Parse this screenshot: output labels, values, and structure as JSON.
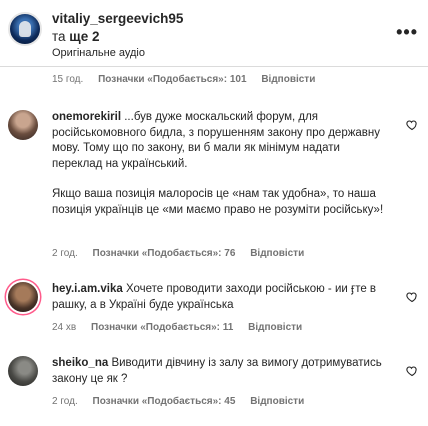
{
  "header": {
    "username": "vitaliy_sergeevich95",
    "subtitle_prefix": "та ",
    "subtitle_bold": "ще 2",
    "audio": "Оригінальне аудіо"
  },
  "top_meta": {
    "time": "15 год.",
    "likes": "Позначки «Подобається»: 101",
    "reply": "Відповісти"
  },
  "comments": [
    {
      "username": "onemorekiril",
      "text1": "...був дуже москальский форум, для російськомовного бидла, з порушенням закону про державну мову. Тому що по закону, ви б мали як мінімум надати переклад на український.",
      "text2": "Якщо ваша позиція малоросів це «нам так удобна», то наша позиція українців це «ми маємо право не розуміти російську»!",
      "time": "2 год.",
      "likes": "Позначки «Подобається»: 76",
      "reply": "Відповісти"
    },
    {
      "username": "hey.i.am.vika",
      "text1": "Хочете проводити заходи російською - ии   ӻте в рашку, а в Україні буде українська",
      "time": "24 хв",
      "likes": "Позначки «Подобається»: 11",
      "reply": "Відповісти"
    },
    {
      "username": "sheiko_na",
      "text1": "Виводити дівчину із залу за вимогу дотримуватись закону це як ?",
      "time": "2 год.",
      "likes": "Позначки «Подобається»: 45",
      "reply": "Відповісти"
    }
  ],
  "icons": {
    "more": "more-options-icon",
    "like": "heart-icon"
  }
}
